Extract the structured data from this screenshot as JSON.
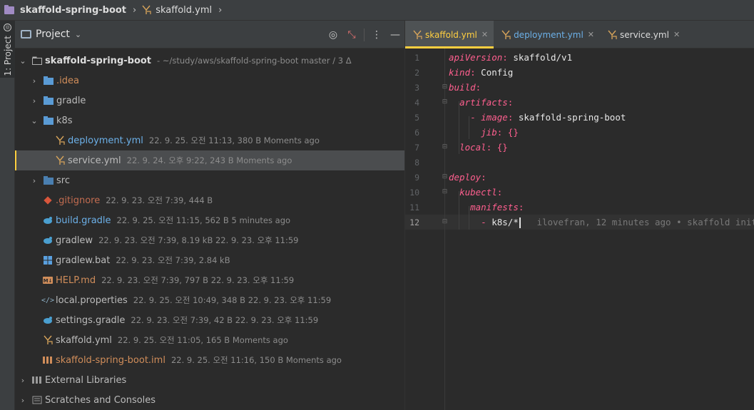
{
  "navbar": {
    "project": "skaffold-spring-boot",
    "file": "skaffold.yml"
  },
  "stripe": {
    "project_tab": "1: Project"
  },
  "project_panel": {
    "title": "Project",
    "tree": [
      {
        "name": "skaffold-spring-boot",
        "meta": "- ~/study/aws/skaffold-spring-boot master / 3 Δ"
      },
      {
        "name": ".idea",
        "meta": ""
      },
      {
        "name": "gradle",
        "meta": ""
      },
      {
        "name": "k8s",
        "meta": ""
      },
      {
        "name": "deployment.yml",
        "meta": "22. 9. 25. 오전 11:13, 380 B Moments ago"
      },
      {
        "name": "service.yml",
        "meta": "22. 9. 24. 오후 9:22, 243 B Moments ago"
      },
      {
        "name": "src",
        "meta": ""
      },
      {
        "name": ".gitignore",
        "meta": "22. 9. 23. 오전 7:39, 444 B"
      },
      {
        "name": "build.gradle",
        "meta": "22. 9. 25. 오전 11:15, 562 B 5 minutes ago"
      },
      {
        "name": "gradlew",
        "meta": "22. 9. 23. 오전 7:39, 8.19 kB 22. 9. 23. 오후 11:59"
      },
      {
        "name": "gradlew.bat",
        "meta": "22. 9. 23. 오전 7:39, 2.84 kB"
      },
      {
        "name": "HELP.md",
        "meta": "22. 9. 23. 오전 7:39, 797 B 22. 9. 23. 오후 11:59"
      },
      {
        "name": "local.properties",
        "meta": "22. 9. 25. 오전 10:49, 348 B 22. 9. 23. 오후 11:59"
      },
      {
        "name": "settings.gradle",
        "meta": "22. 9. 23. 오전 7:39, 42 B 22. 9. 23. 오후 11:59"
      },
      {
        "name": "skaffold.yml",
        "meta": "22. 9. 25. 오전 11:05, 165 B Moments ago"
      },
      {
        "name": "skaffold-spring-boot.iml",
        "meta": "22. 9. 25. 오전 11:16, 150 B Moments ago"
      },
      {
        "name": "External Libraries",
        "meta": ""
      },
      {
        "name": "Scratches and Consoles",
        "meta": ""
      }
    ]
  },
  "editor_tabs": [
    {
      "label": "skaffold.yml",
      "active": true
    },
    {
      "label": "deployment.yml",
      "active": false
    },
    {
      "label": "service.yml",
      "active": false
    }
  ],
  "editor": {
    "line_numbers": [
      "1",
      "2",
      "3",
      "4",
      "5",
      "6",
      "7",
      "8",
      "9",
      "10",
      "11",
      "12"
    ],
    "lines": [
      {
        "key": "apiVersion",
        "sep": ": ",
        "val": "skaffold/v1"
      },
      {
        "key": "kind",
        "sep": ": ",
        "val": "Config"
      },
      {
        "key": "build",
        "sep": ":",
        "val": ""
      },
      {
        "key": "artifacts",
        "sep": ":",
        "val": ""
      },
      {
        "key": "image",
        "sep": ": ",
        "val": "skaffold-spring-boot"
      },
      {
        "key": "jib",
        "sep": ": ",
        "val": "{}"
      },
      {
        "key": "local",
        "sep": ": ",
        "val": "{}"
      },
      {
        "key": "",
        "sep": "",
        "val": ""
      },
      {
        "key": "deploy",
        "sep": ":",
        "val": ""
      },
      {
        "key": "kubectl",
        "sep": ":",
        "val": ""
      },
      {
        "key": "manifests",
        "sep": ":",
        "val": ""
      },
      {
        "key": "",
        "sep": "",
        "val": "k8s/*"
      }
    ],
    "dash": "- ",
    "blame": "ilovefran, 12 minutes ago • skaffold init"
  },
  "colors": {
    "accent": "#ffcf40",
    "key": "#ff5f8f",
    "selection": "#4b4d4f"
  }
}
